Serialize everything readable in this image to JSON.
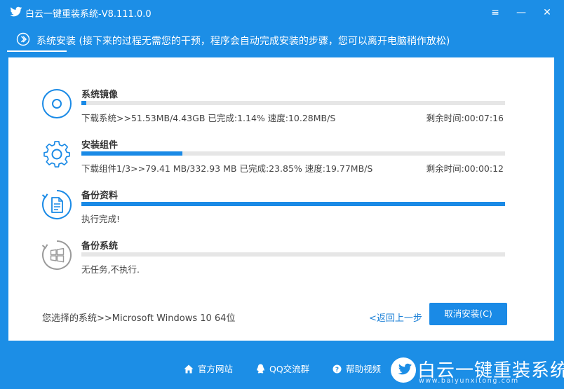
{
  "window": {
    "title": "白云一键重装系统-V8.111.0.0",
    "controls": {
      "menu": "≡",
      "minimize": "—",
      "close": "✕"
    }
  },
  "step": {
    "label": "系统安装 (接下来的过程无需您的干预，程序会自动完成安装的步骤，您可以离开电脑稍作放松)"
  },
  "tasks": [
    {
      "title": "系统镜像",
      "progress": 0.0114,
      "info": "下载系统>>51.53MB/4.43GB 已完成:1.14%  速度:10.28MB/S",
      "remain": "剩余时间:00:07:16",
      "icon": "disc-icon"
    },
    {
      "title": "安装组件",
      "progress": 0.2385,
      "info": "下载组件1/3>>79.41 MB/332.93 MB 已完成:23.85%  速度:19.77MB/S",
      "remain": "剩余时间:00:00:12",
      "icon": "gear-icon"
    },
    {
      "title": "备份资料",
      "progress": 1.0,
      "info": "执行完成!",
      "remain": "",
      "icon": "document-icon"
    },
    {
      "title": "备份系统",
      "progress": 0.0,
      "info": "无任务,不执行.",
      "remain": "",
      "icon": "windows-icon"
    }
  ],
  "bottom": {
    "selected_system": "您选择的系统>>Microsoft Windows 10 64位",
    "back_label": "<返回上一步",
    "cancel_label": "取消安装(C)"
  },
  "footer": {
    "links": [
      "官方网站",
      "QQ交流群",
      "帮助视频"
    ],
    "brand_name": "白云一键重装系统",
    "brand_url": "www.baiyunxitong.com"
  },
  "colors": {
    "accent": "#1a8ae6",
    "background": "#1c8ee6",
    "track": "#e6e6e6",
    "icon_active": "#1a8ae6",
    "icon_idle": "#9a9a9a"
  }
}
